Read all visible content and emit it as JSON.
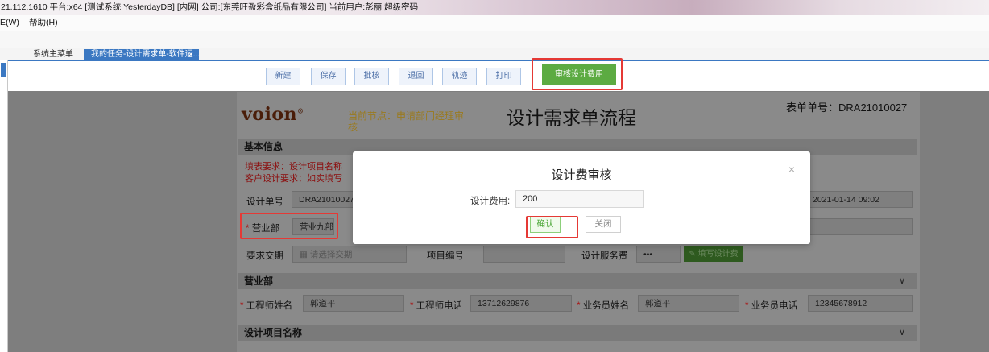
{
  "window": {
    "title": "21.112.1610 平台:x64  [测试系统 YesterdayDB] [内网] 公司:[东莞旺盈彩盒纸品有限公司] 当前用户:彭丽  超级密码"
  },
  "menubar": {
    "items": [
      "E(W)",
      "帮助(H)"
    ]
  },
  "tabs": {
    "main": "系统主菜单",
    "active": "我的任务-设计需求单-软件运...",
    "close": "×"
  },
  "toolbar": {
    "new": "新建",
    "save": "保存",
    "approve": "批核",
    "return": "退回",
    "track": "轨迹",
    "print": "打印",
    "review_fee": "审核设计费用"
  },
  "form": {
    "logo": "voion",
    "logo_mark": "®",
    "current_node": "当前节点：申请部门经理审核",
    "title": "设计需求单流程",
    "form_no": "表单单号：DRA21010027",
    "basic_info": {
      "heading": "基本信息",
      "req_line1": "填表要求：设计项目名称",
      "req_line2": "客户设计要求：如实填写",
      "design_no_label": "设计单号",
      "design_no_value": "DRA21010027",
      "date_value": "2021-01-14 09:02",
      "dept_label": "营业部",
      "dept_value": "营业九部",
      "due_label": "要求交期",
      "due_placeholder": "请选择交期",
      "project_no_label": "项目编号",
      "service_fee_label": "设计服务费",
      "service_fee_dots": "•••",
      "fill_fee_button": "填写设计费"
    },
    "sales": {
      "heading": "营业部",
      "engineer_name_label": "工程师姓名",
      "engineer_name": "郭道平",
      "engineer_phone_label": "工程师电话",
      "engineer_phone": "13712629876",
      "salesman_name_label": "业务员姓名",
      "salesman_name": "郭道平",
      "salesman_phone_label": "业务员电话",
      "salesman_phone": "12345678912"
    },
    "project": {
      "heading": "设计项目名称"
    }
  },
  "modal": {
    "title": "设计费审核",
    "close": "×",
    "fee_label": "设计费用:",
    "fee_value": "200",
    "ok": "确认",
    "cancel": "关闭"
  },
  "colors": {
    "tab_active": "#3b78c2",
    "approve_green": "#5cab42",
    "highlight_red": "#e53935",
    "required_red": "#a11111"
  }
}
